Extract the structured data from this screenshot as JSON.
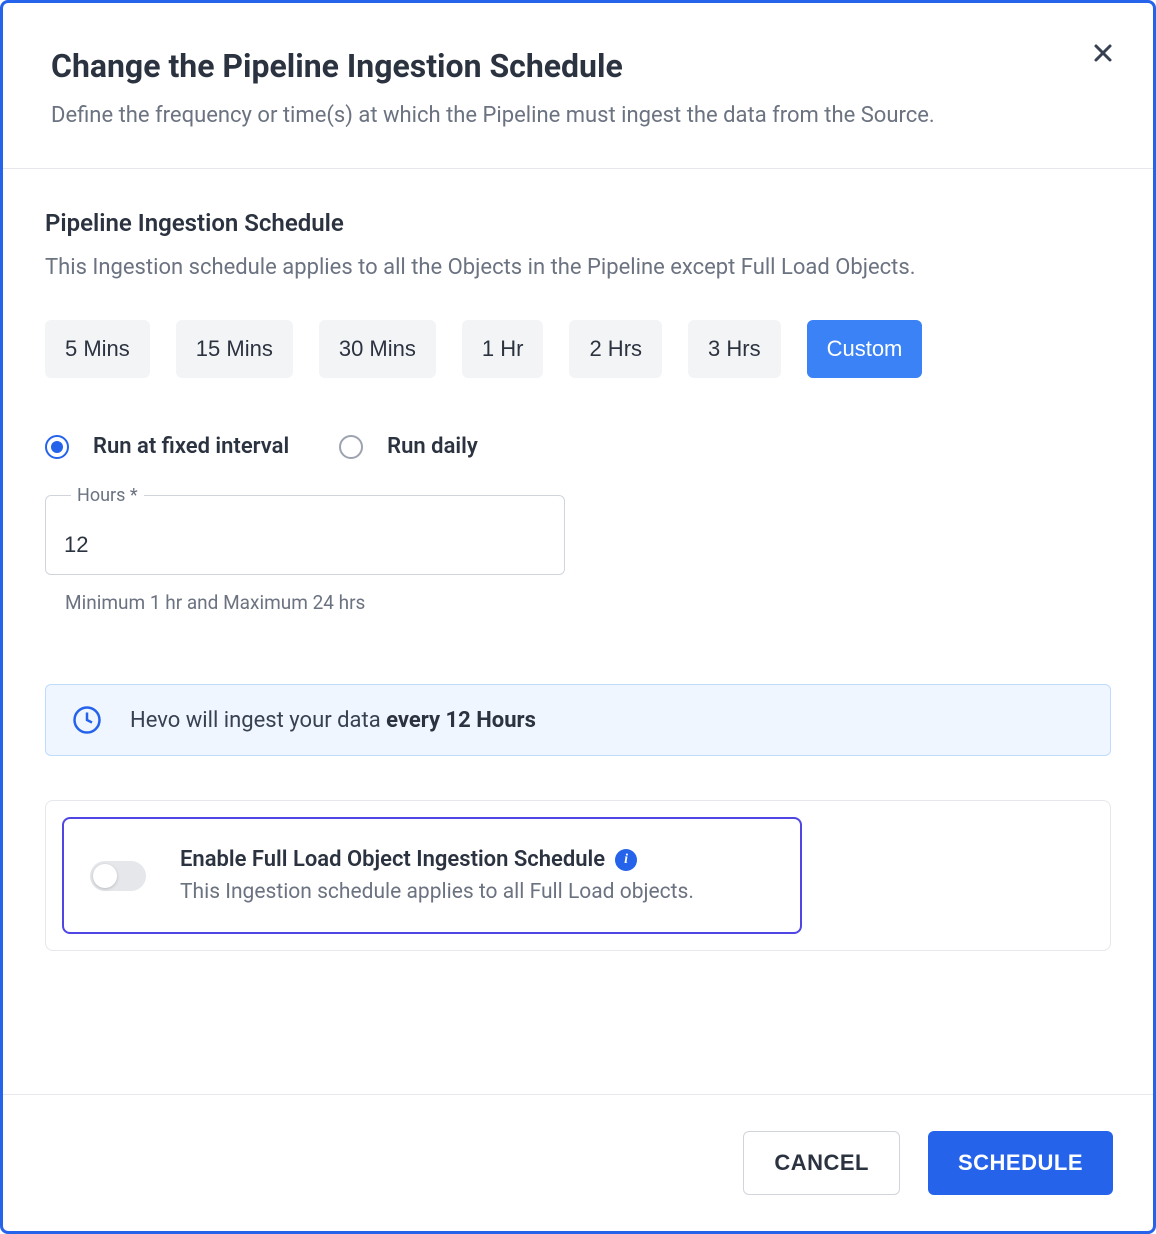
{
  "header": {
    "title": "Change the Pipeline Ingestion Schedule",
    "subtitle": "Define the frequency or time(s) at which the Pipeline must ingest the data from the Source."
  },
  "section": {
    "title": "Pipeline Ingestion Schedule",
    "description": "This Ingestion schedule applies to all the Objects in the Pipeline except Full Load Objects."
  },
  "intervals": [
    "5 Mins",
    "15 Mins",
    "30 Mins",
    "1 Hr",
    "2 Hrs",
    "3 Hrs",
    "Custom"
  ],
  "selected_interval": "Custom",
  "radios": {
    "fixed_interval": "Run at fixed interval",
    "daily": "Run daily",
    "selected": "fixed_interval"
  },
  "hours_input": {
    "label": "Hours *",
    "value": "12",
    "helper": "Minimum 1 hr and Maximum 24 hrs"
  },
  "banner": {
    "prefix": "Hevo will ingest your data ",
    "bold": "every 12 Hours"
  },
  "full_load": {
    "title": "Enable Full Load Object Ingestion Schedule",
    "description": "This Ingestion schedule applies to all Full Load objects.",
    "enabled": false
  },
  "footer": {
    "cancel": "CANCEL",
    "schedule": "SCHEDULE"
  }
}
